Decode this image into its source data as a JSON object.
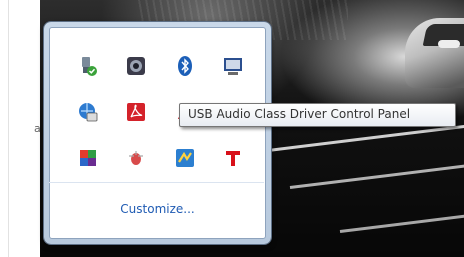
{
  "background": {
    "partial_text": "ab"
  },
  "tray": {
    "icons": [
      {
        "name": "usb-safely-remove-icon"
      },
      {
        "name": "webcam-icon"
      },
      {
        "name": "bluetooth-icon"
      },
      {
        "name": "display-settings-icon"
      },
      {
        "name": "network-connection-icon"
      },
      {
        "name": "adobe-acrobat-icon"
      },
      {
        "name": "usb-audio-control-icon"
      },
      {
        "name": "generic-app-icon"
      },
      {
        "name": "windows-colored-icon"
      },
      {
        "name": "mouse-settings-icon"
      },
      {
        "name": "update-manager-icon"
      },
      {
        "name": "red-t-app-icon"
      }
    ],
    "customize_label": "Customize..."
  },
  "tooltip": {
    "text": "USB Audio Class Driver Control Panel"
  }
}
